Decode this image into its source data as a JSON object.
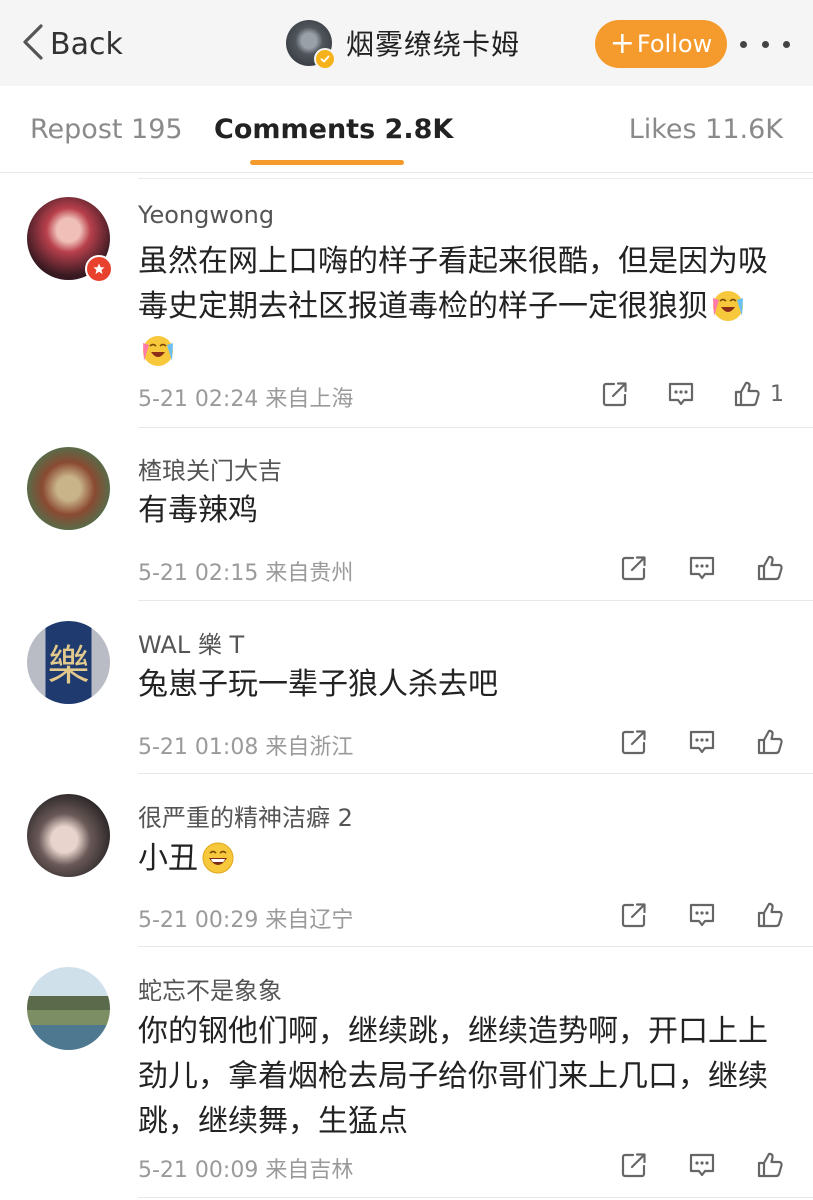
{
  "nav": {
    "back_label": "Back",
    "title": "烟雾缭绕卡姆",
    "follow_plus": "+",
    "follow_label": "Follow"
  },
  "tabs": {
    "repost": "Repost 195",
    "comments": "Comments 2.8K",
    "likes": "Likes 11.6K"
  },
  "comments": [
    {
      "name": "Yeongwong",
      "text_line1": "虽然在网上口嗨的样子看起来很酷，但是因为吸",
      "text_line2": "毒史定期去社区报道毒检的样子一定很狼狈",
      "meta": "5-21 02:24  来自上海",
      "likes": "1"
    },
    {
      "name": "楂琅关门大吉",
      "text": "有毒辣鸡",
      "meta": "5-21 02:15  来自贵州"
    },
    {
      "name": "WAL 樂 T",
      "text": "兔崽子玩一辈子狼人杀去吧",
      "meta": "5-21 01:08  来自浙江"
    },
    {
      "name": "很严重的精神洁癖 2",
      "text": "小丑",
      "meta": "5-21 00:29  来自辽宁"
    },
    {
      "name": "蛇忘不是象象",
      "text_line1": "你的钢他们啊，继续跳，继续造势啊，开口上上",
      "text_line2": "劲儿，拿着烟枪去局子给你哥们来上几口，继续",
      "text_line3": "跳，继续舞，生猛点",
      "meta": "5-21 00:09  来自吉林"
    }
  ],
  "colors": {
    "accent": "#f59a2c",
    "verified": "#f6b21a",
    "member_badge": "#e8412e"
  }
}
